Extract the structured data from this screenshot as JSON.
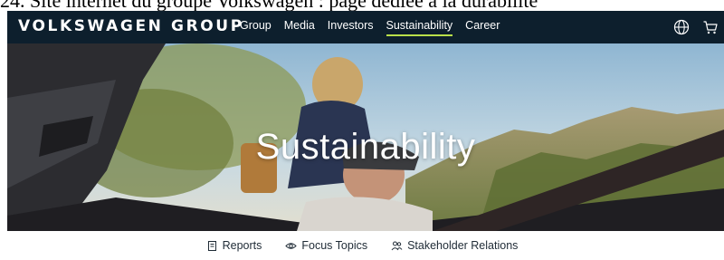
{
  "caption": {
    "text": "24. Site internet du groupe Volkswagen : page dédiée à la durabilité"
  },
  "header": {
    "logo": "VOLKSWAGEN GROUP",
    "nav": [
      {
        "label": "Group",
        "active": false
      },
      {
        "label": "Media",
        "active": false
      },
      {
        "label": "Investors",
        "active": false
      },
      {
        "label": "Sustainability",
        "active": true
      },
      {
        "label": "Career",
        "active": false
      }
    ],
    "icons": [
      "globe-icon",
      "cart-icon"
    ]
  },
  "hero": {
    "title": "Sustainability"
  },
  "subnav": [
    {
      "label": "Reports",
      "icon": "report-icon"
    },
    {
      "label": "Focus Topics",
      "icon": "eye-icon"
    },
    {
      "label": "Stakeholder Relations",
      "icon": "people-icon"
    }
  ],
  "colors": {
    "nav_bg": "#0d1f2d",
    "active_underline": "#b9e04a",
    "text": "#1f2b36"
  }
}
